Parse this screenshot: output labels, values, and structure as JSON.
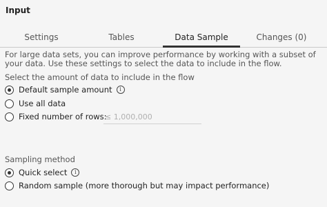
{
  "panel": {
    "title": "Input"
  },
  "tabs": [
    {
      "label": "Settings"
    },
    {
      "label": "Tables"
    },
    {
      "label": "Data Sample"
    },
    {
      "label": "Changes (0)"
    }
  ],
  "active_tab": "Data Sample",
  "data_sample": {
    "description": "For large data sets, you can improve performance by working with a subset of your data. Use these settings to select the data to include in the flow.",
    "amount_label": "Select the amount of data to include in the flow",
    "amount_options": [
      {
        "label": "Default sample amount",
        "checked": true
      },
      {
        "label": "Use all data",
        "checked": false
      },
      {
        "label": "Fixed number of rows:",
        "checked": false
      }
    ],
    "rows_placeholder": "≤ 1,000,000",
    "method_label": "Sampling method",
    "method_options": [
      {
        "label": "Quick select",
        "checked": true
      },
      {
        "label": "Random sample (more thorough but may impact performance)",
        "checked": false
      }
    ]
  },
  "icons": {
    "info": "info-circle-icon"
  }
}
